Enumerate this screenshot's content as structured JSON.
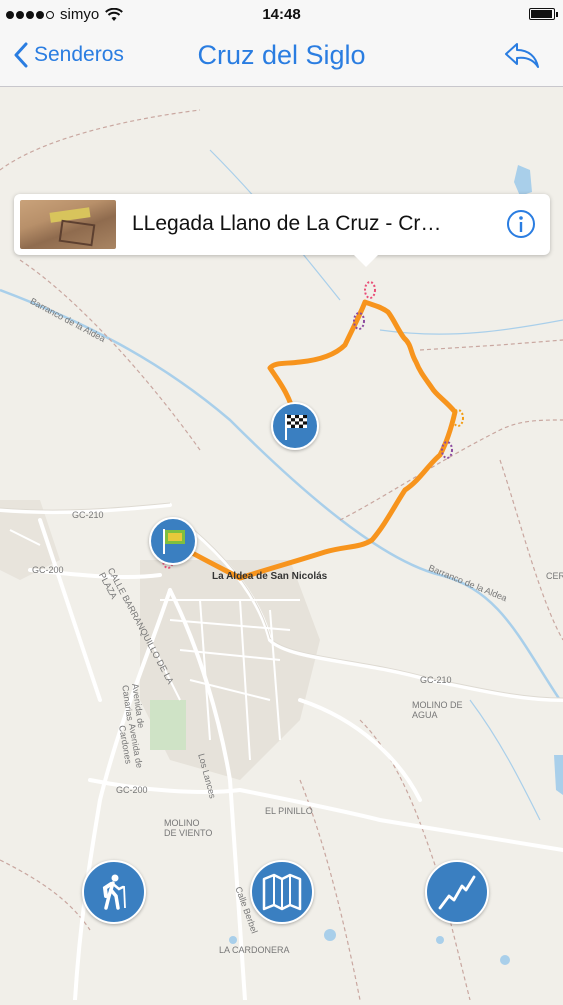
{
  "status": {
    "carrier": "simyo",
    "time": "14:48",
    "signal_bars": 4,
    "battery_level": 0.95
  },
  "nav": {
    "back_label": "Senderos",
    "title": "Cruz del Siglo",
    "back_icon": "chevron-left-icon",
    "share_icon": "reply-arrow-icon"
  },
  "callout": {
    "title": "LLegada Llano de La Cruz - Cr…",
    "info_icon": "info-icon"
  },
  "map": {
    "labels": {
      "barranco_aldea_1": "Barranco de la Aldea",
      "barranco_aldea_2": "Barranco de la Aldea",
      "gc210_a": "GC-210",
      "gc210_b": "GC-210",
      "gc200_a": "GC-200",
      "gc200_b": "GC-200",
      "town": "La Aldea de San Nicolás",
      "molino_agua": "MOLINO DE AGUA",
      "el_pinillo": "EL PINILLO",
      "molino_viento": "MOLINO DE VIENTO",
      "la_cardonera": "LA CARDONERA",
      "cer": "CER",
      "calle_barranquillo": "CALLE BARRANQUILLO DE LA PLAZA",
      "calle_canarias": "Avenida de Canarias",
      "calle_lances": "Los Lances",
      "calle_berbel": "Calle Berbel",
      "calle_cardones": "Avenida de Cardones"
    },
    "track_color": "#f7941d",
    "water_color": "#a9cfea",
    "button_color": "#3a7fc1"
  },
  "toolbar": {
    "hiker_icon": "hiker-icon",
    "map_icon": "folded-map-icon",
    "profile_icon": "elevation-profile-icon"
  }
}
